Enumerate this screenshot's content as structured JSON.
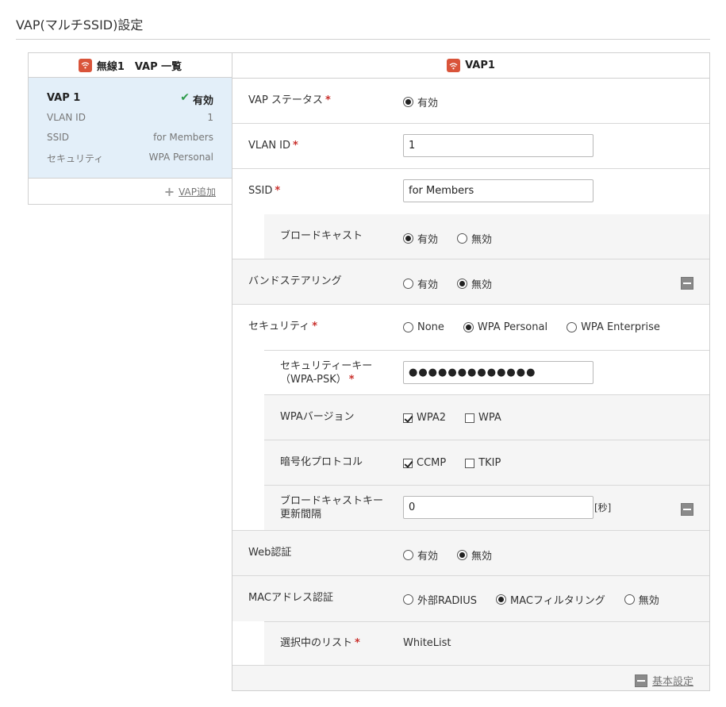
{
  "page": {
    "title": "VAP(マルチSSID)設定"
  },
  "left_panel": {
    "header": "無線1　VAP 一覧",
    "card": {
      "name": "VAP 1",
      "status": "有効",
      "rows": [
        {
          "label": "VLAN ID",
          "value": "1"
        },
        {
          "label": "SSID",
          "value": "for Members"
        },
        {
          "label": "セキュリティ",
          "value": "WPA Personal"
        }
      ]
    },
    "add_label": "VAP追加"
  },
  "right_panel": {
    "header": "VAP1",
    "vap_status": {
      "label": "VAP ステータス",
      "opt_enabled": "有効"
    },
    "vlan_id": {
      "label": "VLAN ID",
      "value": "1"
    },
    "ssid": {
      "label": "SSID",
      "value": "for Members"
    },
    "broadcast": {
      "label": "ブロードキャスト",
      "opt_enabled": "有効",
      "opt_disabled": "無効",
      "selected": "enabled"
    },
    "band_steering": {
      "label": "バンドステアリング",
      "opt_enabled": "有効",
      "opt_disabled": "無効",
      "selected": "disabled"
    },
    "security": {
      "label": "セキュリティ",
      "opt_none": "None",
      "opt_personal": "WPA Personal",
      "opt_enterprise": "WPA Enterprise",
      "selected": "personal"
    },
    "security_key": {
      "label_line1": "セキュリティーキー",
      "label_line2": "（WPA-PSK）",
      "value": "●●●●●●●●●●●●●"
    },
    "wpa_version": {
      "label": "WPAバージョン",
      "opt_wpa2": "WPA2",
      "opt_wpa": "WPA"
    },
    "encryption": {
      "label": "暗号化プロトコル",
      "opt_ccmp": "CCMP",
      "opt_tkip": "TKIP"
    },
    "broadcast_key": {
      "label_line1": "ブロードキャストキー",
      "label_line2": "更新間隔",
      "value": "0",
      "unit": "[秒]"
    },
    "web_auth": {
      "label": "Web認証",
      "opt_enabled": "有効",
      "opt_disabled": "無効",
      "selected": "disabled"
    },
    "mac_auth": {
      "label": "MACアドレス認証",
      "opt_radius": "外部RADIUS",
      "opt_filter": "MACフィルタリング",
      "opt_disabled": "無効",
      "selected": "filter"
    },
    "selected_list": {
      "label": "選択中のリスト",
      "value": "WhiteList"
    },
    "footer_label": "基本設定"
  },
  "colors": {
    "accent_red": "#d9543a",
    "check_green": "#2e9b4b",
    "required": "#c9302c",
    "selected_card": "#e3eff9"
  },
  "icons": [
    "wifi-icon",
    "check-icon",
    "plus-icon",
    "collapse-icon"
  ]
}
